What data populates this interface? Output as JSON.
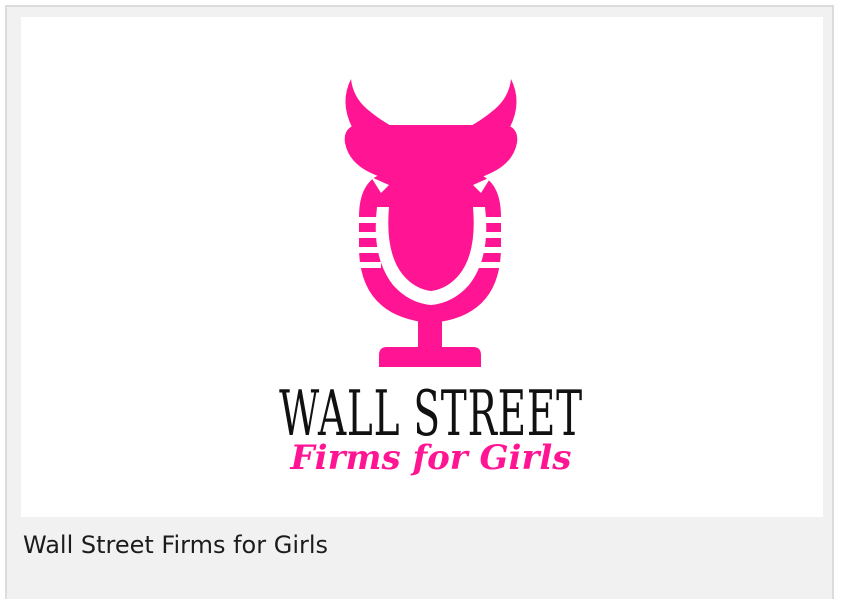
{
  "card": {
    "caption": "Wall Street Firms for Girls"
  },
  "logo": {
    "line1": "WALL STREET",
    "line2": "Firms for Girls"
  },
  "colors": {
    "brand_pink": "#ff1493",
    "text_black": "#111111",
    "card_background": "#f1f1f1",
    "card_border": "#dcdcdc"
  },
  "icons": {
    "logo_mark": "bull-head-microphone-icon"
  }
}
